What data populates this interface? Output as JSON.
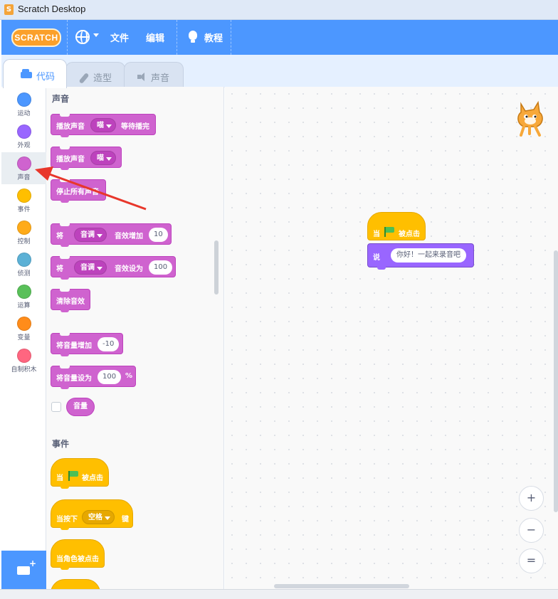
{
  "window": {
    "title": "Scratch Desktop"
  },
  "menubar": {
    "logo": "SCRATCH",
    "file": "文件",
    "edit": "编辑",
    "tutorials": "教程"
  },
  "tabs": [
    {
      "label": "代码",
      "icon": "code-icon",
      "active": true
    },
    {
      "label": "造型",
      "icon": "brush-icon",
      "active": false
    },
    {
      "label": "声音",
      "icon": "speaker-icon",
      "active": false
    }
  ],
  "categories": [
    {
      "label": "运动",
      "color": "#4c97ff"
    },
    {
      "label": "外观",
      "color": "#9966ff"
    },
    {
      "label": "声音",
      "color": "#cf63cf",
      "selected": true
    },
    {
      "label": "事件",
      "color": "#ffbf00"
    },
    {
      "label": "控制",
      "color": "#ffab19"
    },
    {
      "label": "侦测",
      "color": "#5cb1d6"
    },
    {
      "label": "运算",
      "color": "#59c059"
    },
    {
      "label": "变量",
      "color": "#ff8c1a"
    },
    {
      "label": "自制积木",
      "color": "#ff6680"
    }
  ],
  "palette": {
    "sound_title": "声音",
    "events_title": "事件",
    "play_until_done": {
      "prefix": "播放声音",
      "sound": "喵",
      "suffix": "等待播完"
    },
    "start_sound": {
      "prefix": "播放声音",
      "sound": "喵"
    },
    "stop_all_sounds": "停止所有声音",
    "change_effect": {
      "prefix": "将",
      "effect": "音调",
      "middle": "音效增加",
      "value": "10"
    },
    "set_effect": {
      "prefix": "将",
      "effect": "音调",
      "middle": "音效设为",
      "value": "100"
    },
    "clear_effects": "清除音效",
    "change_volume": {
      "label": "将音量增加",
      "value": "-10"
    },
    "set_volume": {
      "label": "将音量设为",
      "value": "100",
      "unit": "%"
    },
    "volume_reporter": "音量",
    "when_flag": {
      "prefix": "当",
      "suffix": "被点击"
    },
    "when_key": {
      "prefix": "当按下",
      "key": "空格",
      "suffix": "键"
    },
    "when_sprite_clicked": "当角色被点击"
  },
  "script": {
    "hat": {
      "prefix": "当",
      "suffix": "被点击"
    },
    "say": {
      "label": "说",
      "message": "你好！一起来录音吧"
    }
  },
  "zoom": {
    "in": "+",
    "out": "−",
    "reset": "="
  }
}
